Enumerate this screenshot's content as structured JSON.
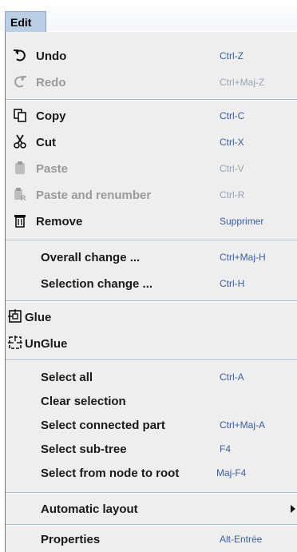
{
  "menubar": {
    "title": "Edit"
  },
  "items": {
    "undo": {
      "label": "Undo",
      "shortcut": "Ctrl-Z",
      "icon": "undo-icon"
    },
    "redo": {
      "label": "Redo",
      "shortcut": "Ctrl+Maj-Z",
      "icon": "redo-icon"
    },
    "copy": {
      "label": "Copy",
      "shortcut": "Ctrl-C",
      "icon": "copy-icon"
    },
    "cut": {
      "label": "Cut",
      "shortcut": "Ctrl-X",
      "icon": "scissors-icon"
    },
    "paste": {
      "label": "Paste",
      "shortcut": "Ctrl-V",
      "icon": "paste-icon"
    },
    "paste_renumber": {
      "label": "Paste and renumber",
      "shortcut": "Ctrl-R",
      "icon": "paste-renumber-icon"
    },
    "remove": {
      "label": "Remove",
      "shortcut": "Supprimer",
      "icon": "trash-icon"
    },
    "overall_change": {
      "label": "Overall change ...",
      "shortcut": "Ctrl+Maj-H"
    },
    "selection_change": {
      "label": "Selection change ...",
      "shortcut": "Ctrl-H"
    },
    "glue": {
      "label": "Glue",
      "icon": "glue-icon"
    },
    "unglue": {
      "label": "UnGlue",
      "icon": "unglue-icon"
    },
    "select_all": {
      "label": "Select all",
      "shortcut": "Ctrl-A"
    },
    "clear_selection": {
      "label": "Clear selection"
    },
    "select_connected": {
      "label": "Select connected part",
      "shortcut": "Ctrl+Maj-A"
    },
    "select_subtree": {
      "label": "Select sub-tree",
      "shortcut": "F4"
    },
    "select_node_root": {
      "label": "Select from node to root",
      "shortcut": "Maj-F4"
    },
    "automatic_layout": {
      "label": "Automatic layout",
      "icon": "submenu-arrow-icon"
    },
    "properties": {
      "label": "Properties",
      "shortcut": "Alt-Entrée"
    }
  },
  "colors": {
    "menu_title_bg": "#b9cfe6",
    "shortcut_text": "#3c5fa0",
    "disabled_text": "#9a9a9a",
    "panel_bg": "#eeeeee"
  }
}
